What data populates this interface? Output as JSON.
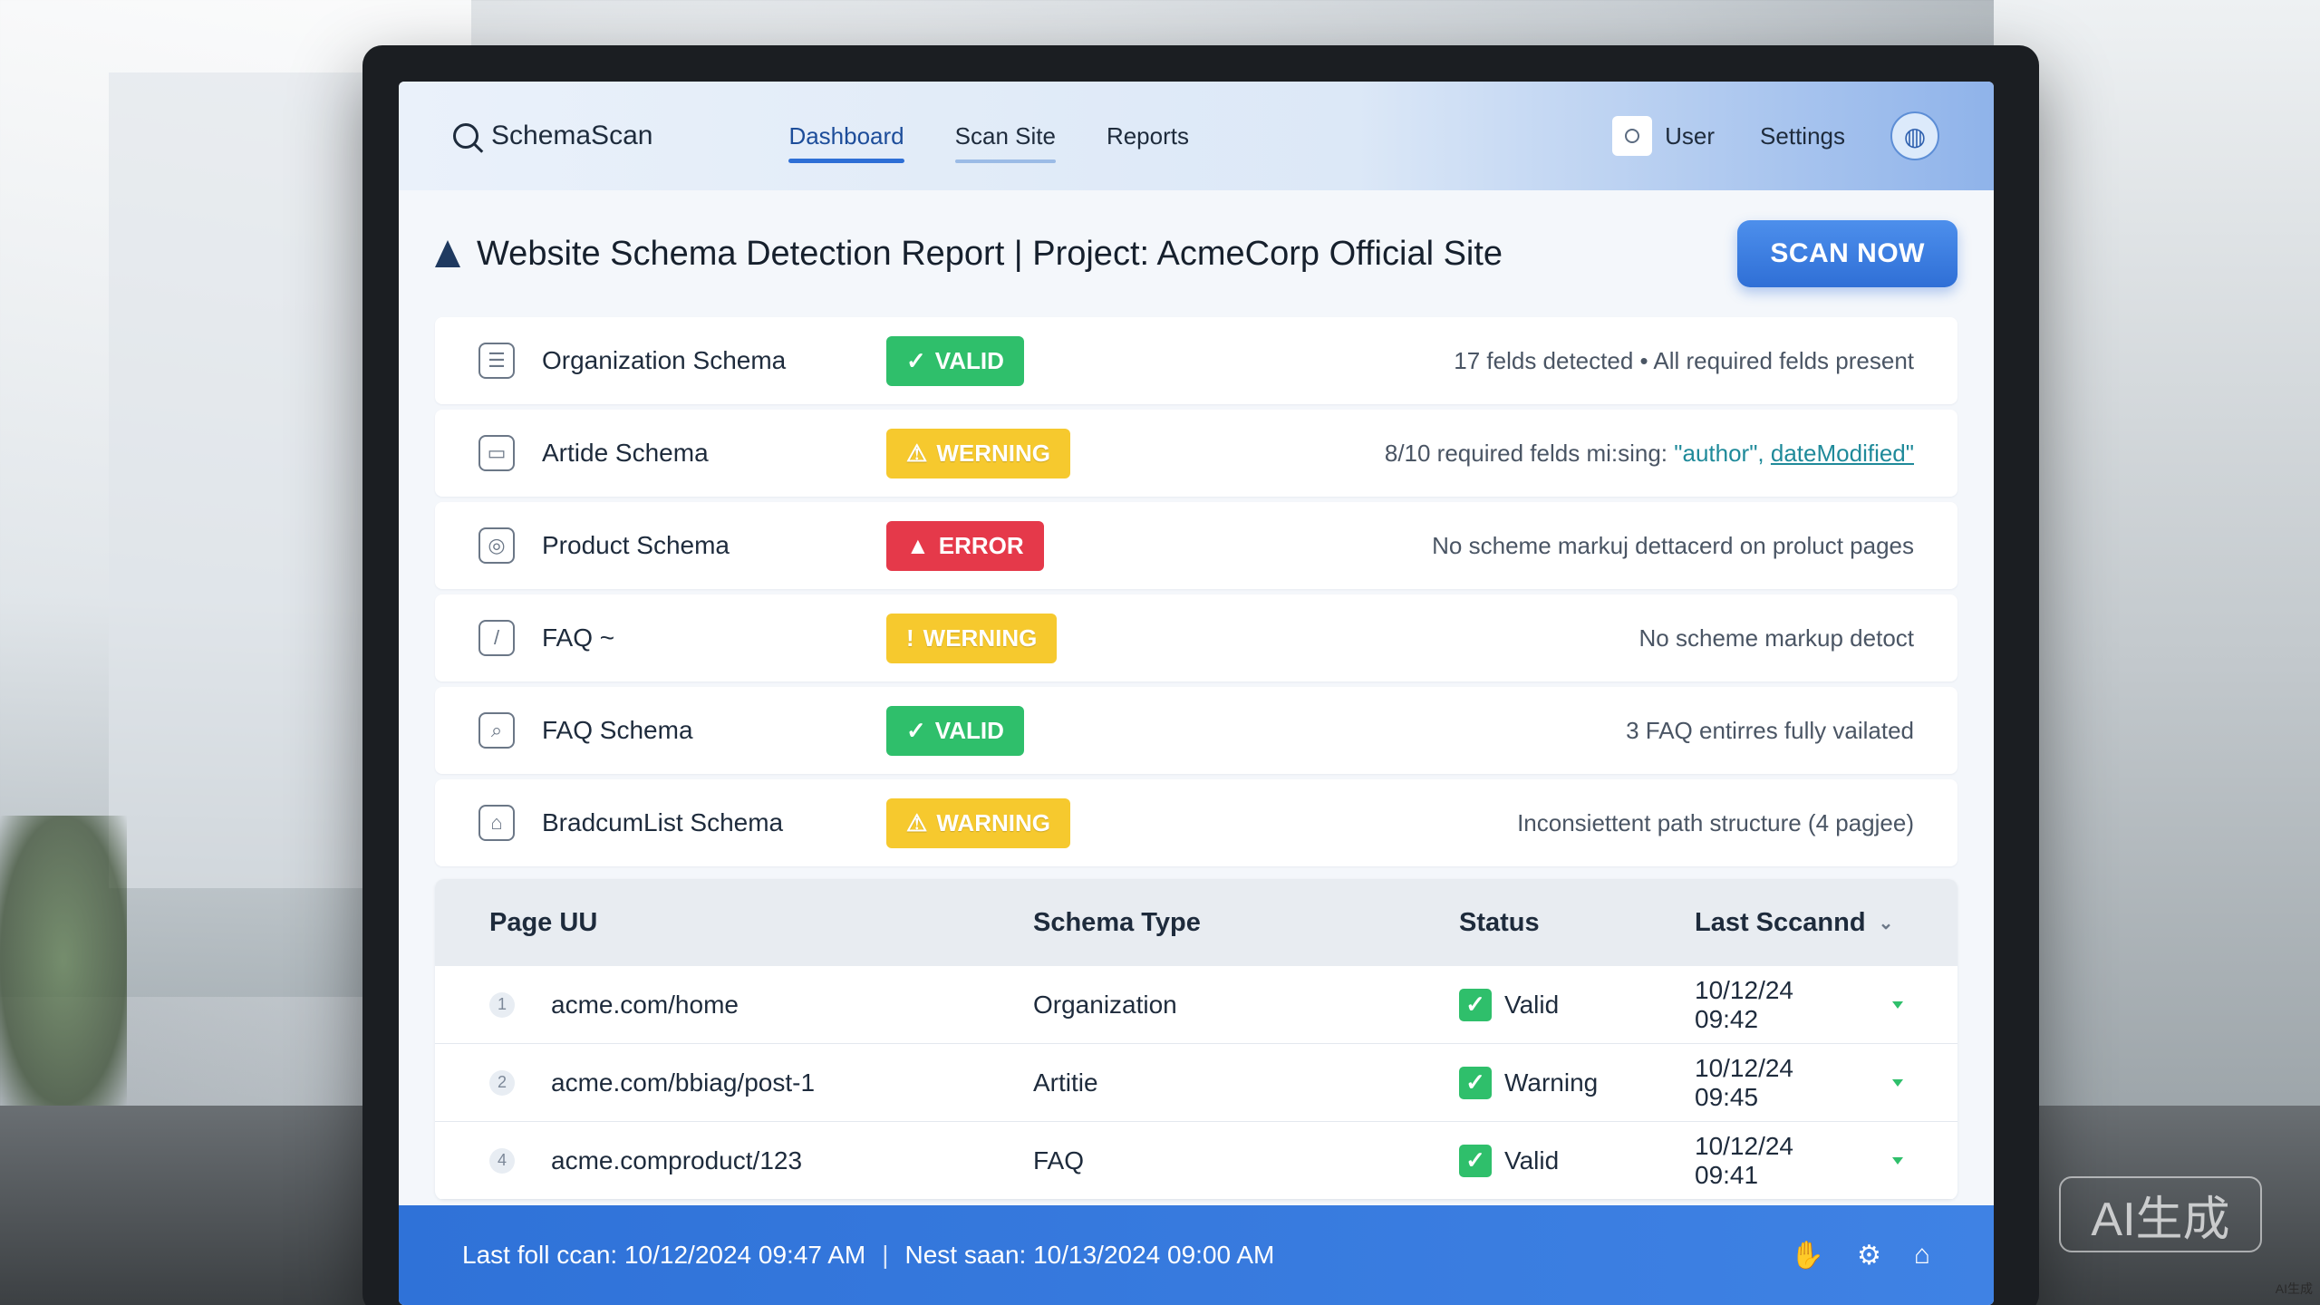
{
  "app": {
    "name": "SchemaScan"
  },
  "nav": {
    "tabs": [
      {
        "label": "Dashboard",
        "active": true
      },
      {
        "label": "Scan Site",
        "active": false
      },
      {
        "label": "Reports",
        "active": false
      }
    ],
    "user_label": "User",
    "settings_label": "Settings"
  },
  "report": {
    "title": "Website Schema Detection Report | Project: AcmeCorp Official Site",
    "scan_button": "SCAN NOW"
  },
  "schemas": [
    {
      "name": "Organization Schema",
      "status": "VALID",
      "status_kind": "valid",
      "icon": "document-icon",
      "detail": "17 felds detected • All required felds present"
    },
    {
      "name": "Artide Schema",
      "status": "WERNING",
      "status_kind": "warning",
      "icon": "article-icon",
      "detail_prefix": "8/10 required felds mi:sing: ",
      "detail_link_1": "\"author\",",
      "detail_link_2": "dateModified\""
    },
    {
      "name": "Product Schema",
      "status": "ERROR",
      "status_kind": "error",
      "icon": "product-icon",
      "detail": "No scheme markuj dettacerd on proluct pages"
    },
    {
      "name": "FAQ ~",
      "status": "WERNING",
      "status_kind": "warning",
      "icon": "faq-icon",
      "detail": "No scheme markup detoct"
    },
    {
      "name": "FAQ Schema",
      "status": "VALID",
      "status_kind": "valid",
      "icon": "faq-schema-icon",
      "detail": "3 FAQ entirres fully vailated"
    },
    {
      "name": "BradcumList Schema",
      "status": "WARNING",
      "status_kind": "warning",
      "icon": "breadcrumb-icon",
      "detail": "Inconsiettent path structure (4 pagjee)"
    }
  ],
  "table": {
    "headers": [
      "Page UU",
      "Schema Type",
      "Status",
      "Last Sccannd"
    ],
    "rows": [
      {
        "num": "1",
        "page": "acme.com/home",
        "type": "Organization",
        "status": "Valid",
        "last": "10/12/24 09:42"
      },
      {
        "num": "2",
        "page": "acme.com/bbiag/post-1",
        "type": "Artitie",
        "status": "Warning",
        "last": "10/12/24 09:45"
      },
      {
        "num": "4",
        "page": "acme.comproduct/123",
        "type": "FAQ",
        "status": "Valid",
        "last": "10/12/24 09:41"
      }
    ]
  },
  "footer": {
    "last_scan": "Last foll ccan: 10/12/2024 09:47 AM",
    "separator": "|",
    "next_scan": "Nest saan: 10/13/2024 09:00 AM"
  },
  "watermark": {
    "badge": "AI生成",
    "small": "AI生成"
  },
  "colors": {
    "accent": "#2f6fd6",
    "valid": "#2fbf6b",
    "warning": "#f6c92e",
    "error": "#e5394a"
  }
}
